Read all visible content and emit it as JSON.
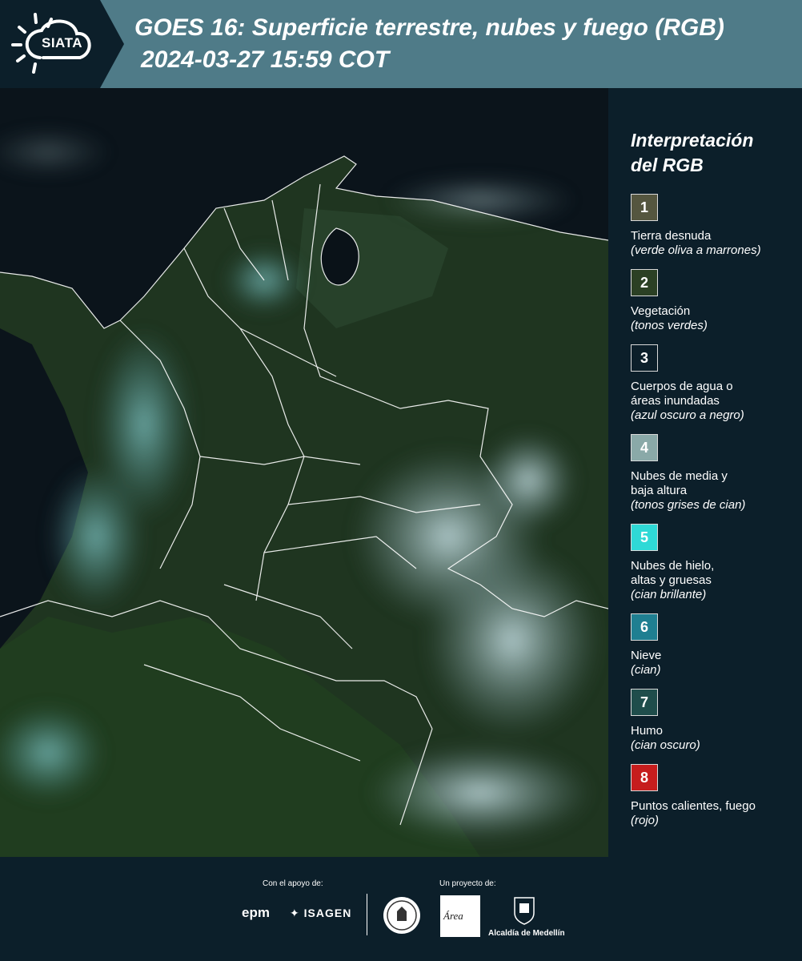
{
  "header": {
    "logo_text": "SIATA",
    "title": "GOES 16: Superficie terrestre, nubes y fuego (RGB)",
    "subtitle": "2024-03-27 15:59 COT",
    "bg_color": "#4f7b88"
  },
  "legend": {
    "title_line1": "Interpretación",
    "title_line2": "del RGB",
    "items": [
      {
        "number": "1",
        "label": "Tierra desnuda",
        "note": "(verde oliva a marrones)",
        "color": "#55563f"
      },
      {
        "number": "2",
        "label": "Vegetación",
        "note": "(tonos verdes)",
        "color": "#2b4024"
      },
      {
        "number": "3",
        "label": "Cuerpos de agua o áreas inundadas",
        "note": "(azul oscuro a negro)",
        "color": "#0c1f2a"
      },
      {
        "number": "4",
        "label": "Nubes de media y baja altura",
        "note": "(tonos grises de cian)",
        "color": "#8aa9a8"
      },
      {
        "number": "5",
        "label": "Nubes de hielo, altas y gruesas",
        "note": "(cian brillante)",
        "color": "#2fd9d6"
      },
      {
        "number": "6",
        "label": "Nieve",
        "note": "(cian)",
        "color": "#1f7f91"
      },
      {
        "number": "7",
        "label": "Humo",
        "note": "(cian oscuro)",
        "color": "#1f4d4b"
      },
      {
        "number": "8",
        "label": "Puntos calientes, fuego",
        "note": "(rojo)",
        "color": "#c61d1d"
      }
    ]
  },
  "footer": {
    "support_label": "Con el apoyo de:",
    "project_label": "Un proyecto de:",
    "sponsor1": "epm",
    "sponsor2": "ISAGEN",
    "metro_logo": "Área",
    "medellin_text": "Alcaldía de Medellín"
  }
}
